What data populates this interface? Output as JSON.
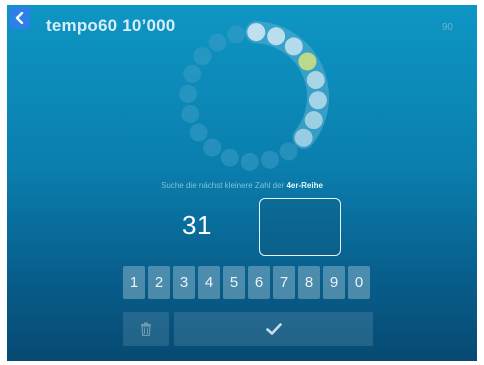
{
  "header": {
    "back_icon": "chevron-left-icon",
    "title": "tempo60 10’000",
    "score": "90"
  },
  "progress": {
    "total_steps": 20,
    "completed_steps": 8,
    "current_step": 4,
    "colors": {
      "done": "#c7e4f0",
      "current": "#bcd98a",
      "pending": "#3c9cc6",
      "track": "#5fb0d4"
    }
  },
  "task": {
    "instruction_prefix": "Suche die nächst kleinere Zahl der ",
    "instruction_highlight": "4er-Reihe",
    "number": "31",
    "answer_value": ""
  },
  "keypad": {
    "keys": [
      "1",
      "2",
      "3",
      "4",
      "5",
      "6",
      "7",
      "8",
      "9",
      "0"
    ]
  },
  "actions": {
    "delete_icon": "trash-icon",
    "submit_icon": "check-icon"
  }
}
